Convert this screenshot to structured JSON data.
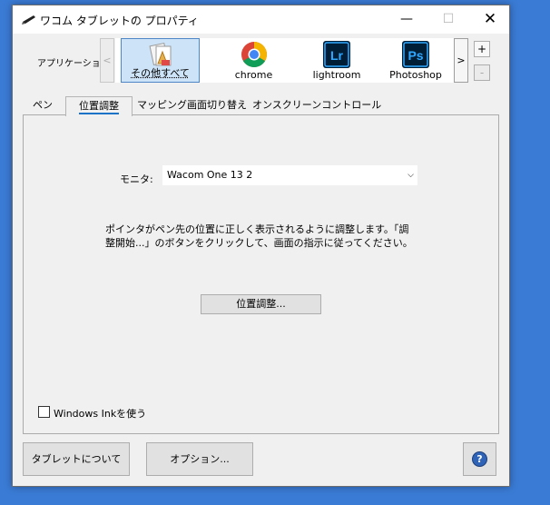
{
  "window": {
    "title": "ワコム タブレットの プロパティ",
    "controls": {
      "minimize": "—",
      "maximize": "☐",
      "close": "✕"
    }
  },
  "application_bar": {
    "label": "アプリケーション:",
    "scroll_left": "<",
    "scroll_right": ">",
    "add": "+",
    "remove": "-",
    "apps": [
      {
        "label": "その他すべて",
        "icon": "all-others-icon",
        "selected": true
      },
      {
        "label": "chrome",
        "icon": "chrome-icon",
        "selected": false
      },
      {
        "label": "lightroom",
        "icon": "lightroom-icon",
        "icon_text": "Lr",
        "selected": false
      },
      {
        "label": "Photoshop",
        "icon": "photoshop-icon",
        "icon_text": "Ps",
        "selected": false
      }
    ]
  },
  "tabs": [
    {
      "label": "ペン",
      "active": false
    },
    {
      "label": "位置調整",
      "active": true
    },
    {
      "label": "マッピング画面切り替え",
      "active": false
    },
    {
      "label": "オンスクリーンコントロール",
      "active": false
    }
  ],
  "calibration": {
    "monitor_label": "モニタ:",
    "monitor_value": "Wacom One 13 2",
    "description": "ポインタがペン先の位置に正しく表示されるように調整します。「調整開始...」のボタンをクリックして、画面の指示に従ってください。",
    "button_label": "位置調整..."
  },
  "windows_ink": {
    "label": "Windows Inkを使う",
    "checked": false
  },
  "footer": {
    "about_label": "タブレットについて",
    "options_label": "オプション...",
    "help_label": "?"
  },
  "colors": {
    "desktop": "#3a7bd5",
    "selection": "#cde3f7",
    "selection_border": "#4e86c6",
    "tab_underline": "#1a73c7",
    "lightroom": "#31a8ff",
    "photoshop": "#31a8ff",
    "help": "#2f63b8"
  }
}
